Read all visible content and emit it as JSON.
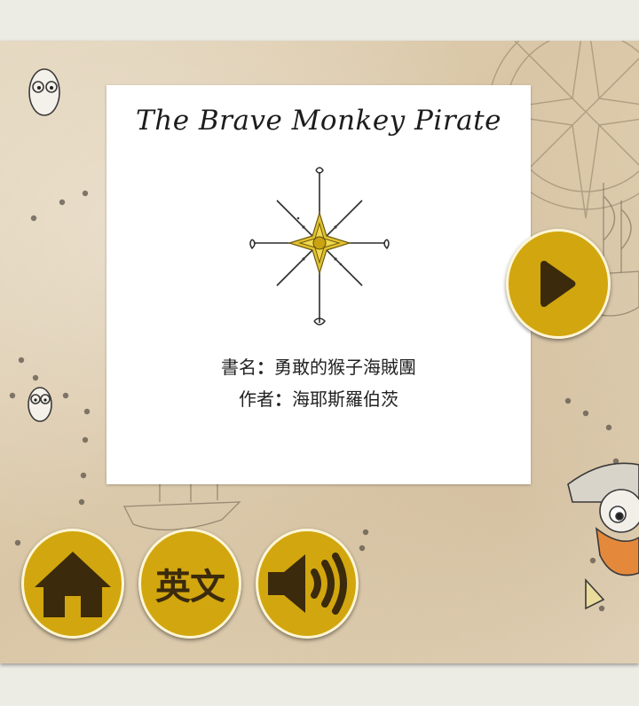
{
  "book": {
    "english_title": "The Brave Monkey Pirate",
    "title_label": "書名",
    "title_value": "勇敢的猴子海賊團",
    "author_label": "作者",
    "author_value": "海耶斯羅伯茨",
    "separator": "："
  },
  "controls": {
    "home_icon": "home-icon",
    "language_label": "英文",
    "audio_icon": "speaker-icon",
    "next_icon": "play-icon"
  },
  "colors": {
    "button": "#d2a60e",
    "button_border": "#fff6d5",
    "icon": "#3b2a0c"
  }
}
